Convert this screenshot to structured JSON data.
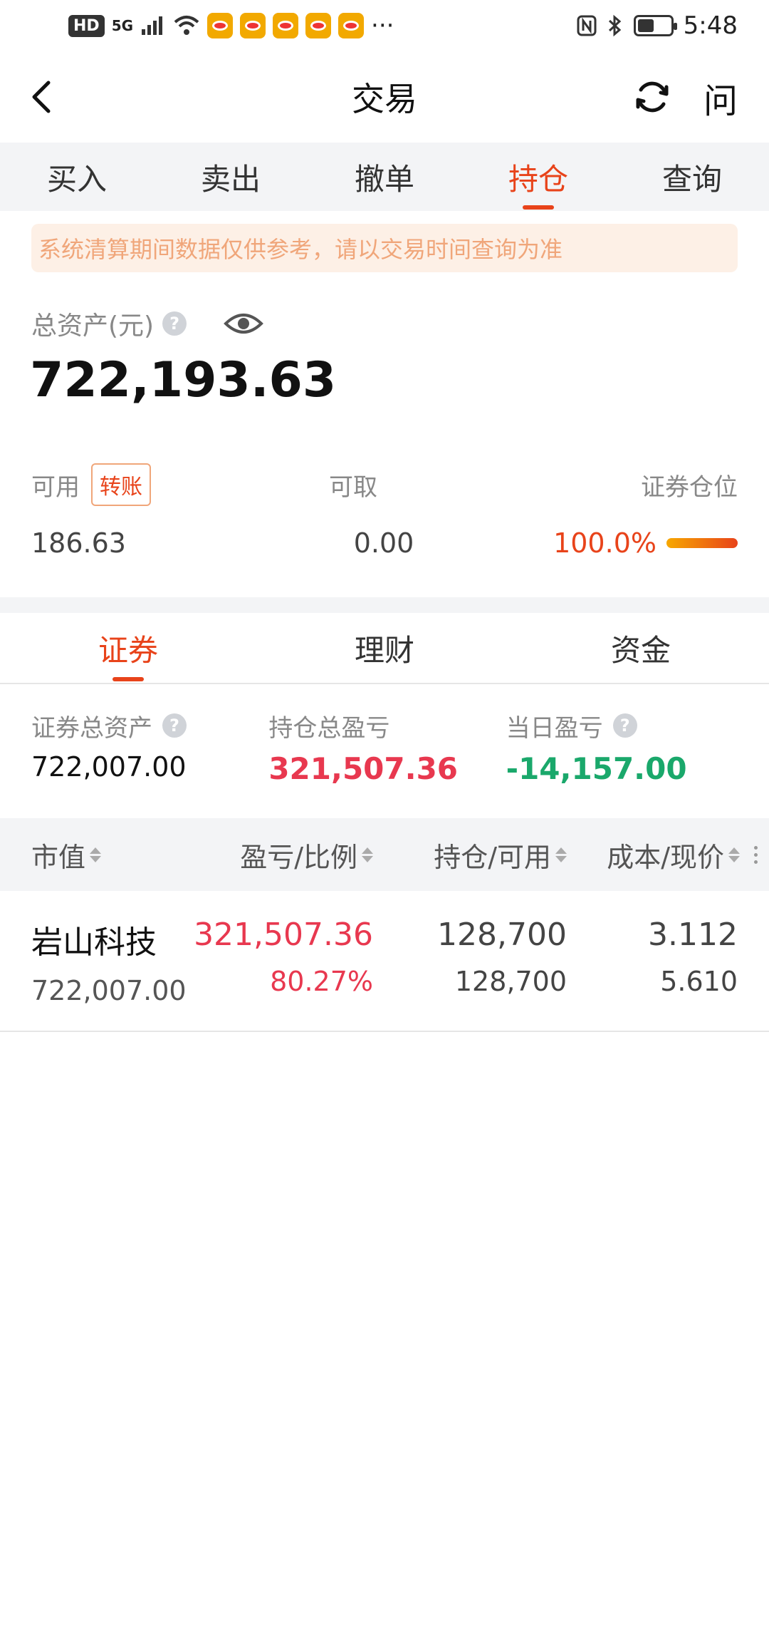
{
  "status_bar": {
    "hd": "HD",
    "network": "5G",
    "more": "···",
    "time": "5:48",
    "battery_level": 0.5
  },
  "header": {
    "title": "交易",
    "ask_label": "问",
    "back_icon": "chevron-left-icon",
    "refresh_icon": "refresh-icon"
  },
  "top_tabs": [
    {
      "label": "买入"
    },
    {
      "label": "卖出"
    },
    {
      "label": "撤单"
    },
    {
      "label": "持仓"
    },
    {
      "label": "查询"
    }
  ],
  "active_top_tab": "持仓",
  "notice": "系统清算期间数据仅供参考，请以交易时间查询为准",
  "assets": {
    "label": "总资产(元)",
    "help": "?",
    "value": "722,193.63"
  },
  "available": {
    "available_label": "可用",
    "transfer_button": "转账",
    "withdrawable_label": "可取",
    "position_label": "证券仓位",
    "available_value": "186.63",
    "withdrawable_value": "0.00",
    "position_value": "100.0%"
  },
  "sub_tabs": [
    {
      "label": "证券"
    },
    {
      "label": "理财"
    },
    {
      "label": "资金"
    }
  ],
  "summary": {
    "total_securities_label": "证券总资产",
    "total_securities_value": "722,007.00",
    "holding_pnl_label": "持仓总盈亏",
    "holding_pnl_value": "321,507.36",
    "daily_pnl_label": "当日盈亏",
    "daily_pnl_value": "-14,157.00",
    "help": "?"
  },
  "table": {
    "headers": [
      "市值",
      "盈亏/比例",
      "持仓/可用",
      "成本/现价"
    ],
    "rows": [
      {
        "name": "岩山科技",
        "market_value": "722,007.00",
        "pnl": "321,507.36",
        "pnl_ratio": "80.27%",
        "holding": "128,700",
        "available": "128,700",
        "cost": "3.112",
        "price": "5.610"
      }
    ]
  },
  "colors": {
    "accent": "#e8431a",
    "profit": "#e8384f",
    "loss": "#1aa86b"
  }
}
